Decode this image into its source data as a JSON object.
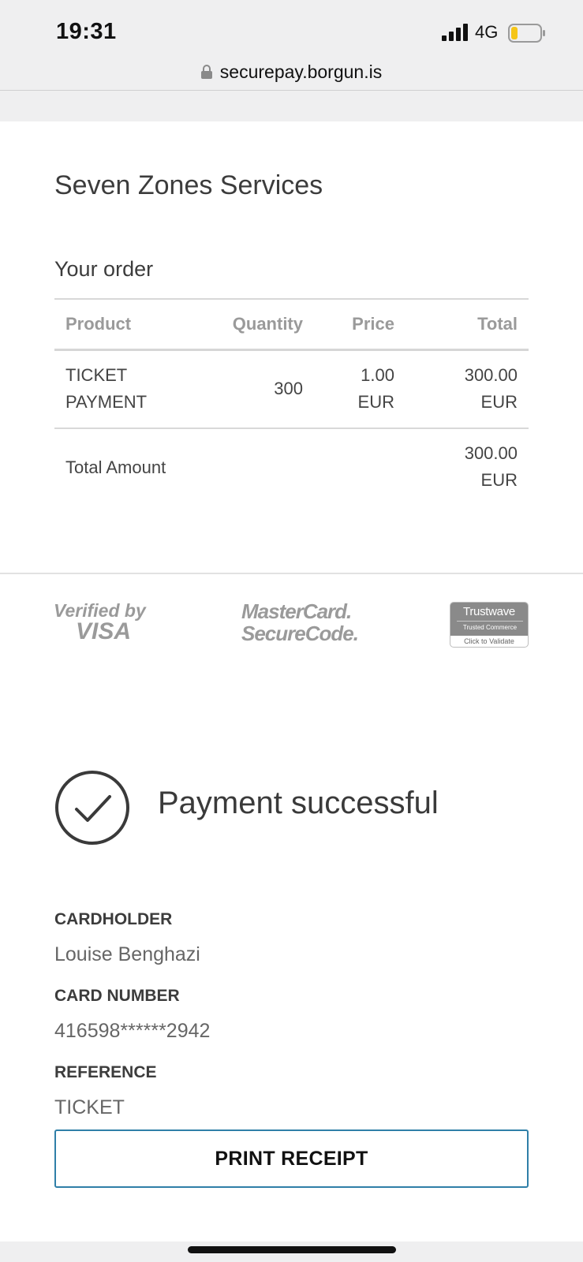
{
  "status_bar": {
    "time": "19:31",
    "network": "4G",
    "battery_level": 0.2,
    "battery_color": "#f5c518"
  },
  "browser": {
    "url": "securepay.borgun.is",
    "lock_icon": "lock-icon"
  },
  "merchant": {
    "name": "Seven Zones Services"
  },
  "order": {
    "title": "Your order",
    "columns": [
      "Product",
      "Quantity",
      "Price",
      "Total"
    ],
    "items": [
      {
        "product_line1": "TICKET",
        "product_line2": "PAYMENT",
        "quantity": "300",
        "price_line1": "1.00",
        "price_line2": "EUR",
        "total_line1": "300.00",
        "total_line2": "EUR"
      }
    ],
    "total_label": "Total Amount",
    "total_line1": "300.00",
    "total_line2": "EUR"
  },
  "security_logos": {
    "visa_line1": "Verified by",
    "visa_line2": "VISA",
    "mastercard_line1": "MasterCard.",
    "mastercard_line2": "SecureCode.",
    "trustwave_name": "Trustwave",
    "trustwave_sub": "Trusted Commerce",
    "trustwave_cta": "Click to Validate"
  },
  "result": {
    "icon": "checkmark-circle-icon",
    "message": "Payment successful"
  },
  "details": {
    "cardholder_label": "CARDHOLDER",
    "cardholder_value": "Louise Benghazi",
    "card_number_label": "CARD NUMBER",
    "card_number_value": "416598******2942",
    "reference_label": "REFERENCE",
    "reference_value": "TICKET"
  },
  "actions": {
    "print_label": "PRINT RECEIPT",
    "accent_color": "#2f7fa8"
  }
}
